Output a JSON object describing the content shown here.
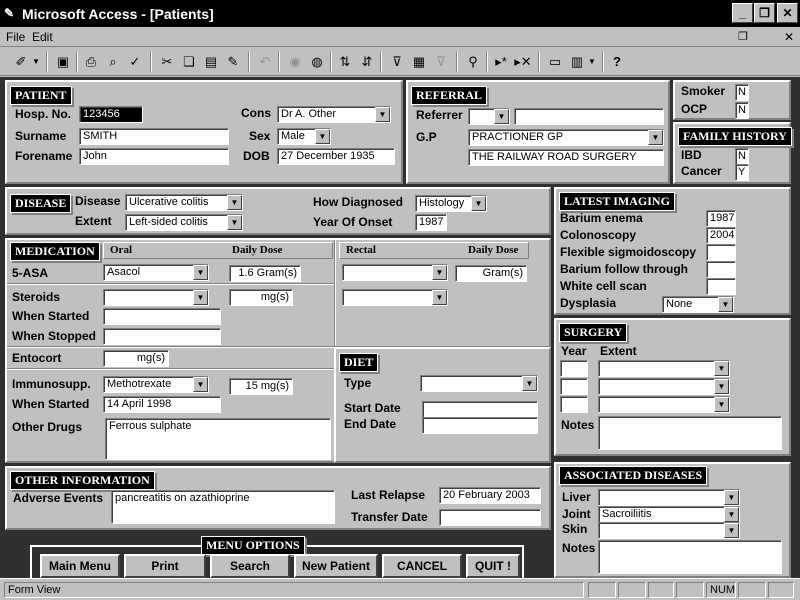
{
  "window": {
    "title": "Microsoft Access - [Patients]"
  },
  "menu": {
    "file": "File",
    "edit": "Edit"
  },
  "patient": {
    "header": "PATIENT",
    "hosp_label": "Hosp. No.",
    "hosp_value": "123456",
    "surname_label": "Surname",
    "surname_value": "SMITH",
    "forename_label": "Forename",
    "forename_value": "John",
    "cons_label": "Cons",
    "cons_value": "Dr A. Other",
    "sex_label": "Sex",
    "sex_value": "Male",
    "dob_label": "DOB",
    "dob_value": "27 December 1935"
  },
  "referral": {
    "header": "REFERRAL",
    "referrer_label": "Referrer",
    "referrer_value": "",
    "gp_label": "G.P",
    "gp_value": "PRACTIONER GP",
    "surgery_value": "THE RAILWAY ROAD SURGERY"
  },
  "smoking": {
    "smoker_label": "Smoker",
    "smoker_value": "N",
    "ocp_label": "OCP",
    "ocp_value": "N"
  },
  "family": {
    "header": "FAMILY HISTORY",
    "ibd_label": "IBD",
    "ibd_value": "N",
    "cancer_label": "Cancer",
    "cancer_value": "Y"
  },
  "disease": {
    "header": "DISEASE",
    "disease_label": "Disease",
    "disease_value": "Ulcerative colitis",
    "extent_label": "Extent",
    "extent_value": "Left-sided colitis",
    "diag_label": "How Diagnosed",
    "diag_value": "Histology",
    "onset_label": "Year Of Onset",
    "onset_value": "1987"
  },
  "imaging": {
    "header": "LATEST IMAGING",
    "items": [
      {
        "label": "Barium enema",
        "value": "1987"
      },
      {
        "label": "Colonoscopy",
        "value": "2004"
      },
      {
        "label": "Flexible sigmoidoscopy",
        "value": ""
      },
      {
        "label": "Barium follow through",
        "value": ""
      },
      {
        "label": "White cell scan",
        "value": ""
      }
    ],
    "dysplasia_label": "Dysplasia",
    "dysplasia_value": "None"
  },
  "medication": {
    "header": "MEDICATION",
    "oral_label": "Oral",
    "oral_dose_label": "Daily Dose",
    "rectal_label": "Rectal",
    "rectal_dose_label": "Daily Dose",
    "asa_label": "5-ASA",
    "asa_oral": "Asacol",
    "asa_oral_dose": "1.6 Gram(s)",
    "asa_rectal_dose": "Gram(s)",
    "steroids_label": "Steroids",
    "steroids_dose": "mg(s)",
    "when_started_label": "When Started",
    "when_stopped_label": "When Stopped",
    "entocort_label": "Entocort",
    "entocort_dose": "mg(s)",
    "immuno_label": "Immunosupp.",
    "immuno_value": "Methotrexate",
    "immuno_dose": "15 mg(s)",
    "immuno_started_label": "When Started",
    "immuno_started_value": "14 April 1998",
    "other_drugs_label": "Other Drugs",
    "other_drugs_value": "Ferrous sulphate"
  },
  "diet": {
    "header": "DIET",
    "type_label": "Type",
    "start_label": "Start Date",
    "end_label": "End Date"
  },
  "surgery": {
    "header": "SURGERY",
    "year_label": "Year",
    "extent_label": "Extent",
    "notes_label": "Notes"
  },
  "other": {
    "header": "OTHER INFORMATION",
    "adverse_label": "Adverse Events",
    "adverse_value": "pancreatitis on azathioprine",
    "relapse_label": "Last Relapse",
    "relapse_value": "20 February 2003",
    "transfer_label": "Transfer  Date"
  },
  "associated": {
    "header": "ASSOCIATED  DISEASES",
    "liver_label": "Liver",
    "joint_label": "Joint",
    "joint_value": "Sacroiliitis",
    "skin_label": "Skin",
    "notes_label": "Notes"
  },
  "menu_options": {
    "header": "MENU OPTIONS",
    "main_menu": "Main Menu",
    "print": "Print",
    "search": "Search",
    "new_patient": "New Patient",
    "cancel": "CANCEL",
    "quit": "QUIT !"
  },
  "status": {
    "view": "Form View",
    "num": "NUM"
  }
}
